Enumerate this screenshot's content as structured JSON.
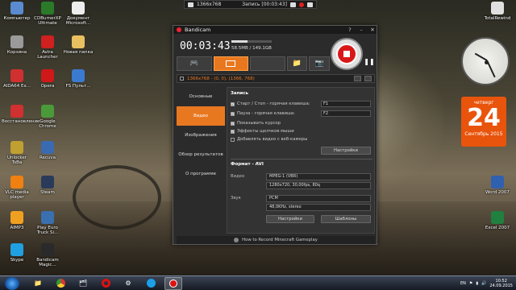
{
  "recording_bar": {
    "resolution": "1366x768",
    "status": "Запись [00:03:43]"
  },
  "desktop_icons": [
    {
      "label": "Компьютер",
      "color": "#5a8ad0"
    },
    {
      "label": "CDBurnerXP Ultimate",
      "color": "#2a7a2a"
    },
    {
      "label": "Документ Microsoft...",
      "color": "#eeeeee"
    },
    {
      "label": "Корзина",
      "color": "#9a9a9a"
    },
    {
      "label": "Avira Launcher",
      "color": "#d02020"
    },
    {
      "label": "Новая папка",
      "color": "#e8c060"
    },
    {
      "label": "AIDA64 Ex...",
      "color": "#d03030"
    },
    {
      "label": "Opera",
      "color": "#d01818"
    },
    {
      "label": "FS Пульт...",
      "color": "#3a7ad0"
    },
    {
      "label": "Восстановление",
      "color": "#d03030"
    },
    {
      "label": "Google Chrome",
      "color": "#4a9a3a"
    },
    {
      "label": "Unlocker TsBa",
      "color": "#c0a030"
    },
    {
      "label": "Recuva",
      "color": "#3a6ab0"
    },
    {
      "label": "VLC media player",
      "color": "#f08010"
    },
    {
      "label": "Steam",
      "color": "#2a3a5a"
    },
    {
      "label": "AIMP3",
      "color": "#f0a020"
    },
    {
      "label": "Play Euro Truck Si...",
      "color": "#3a70b0"
    },
    {
      "label": "Skype",
      "color": "#20a0e0"
    },
    {
      "label": "Bandicam Magic...",
      "color": "#2a2a2a"
    },
    {
      "label": "TotalRewind",
      "color": "#e0e0e0"
    },
    {
      "label": "Word 2007",
      "color": "#3060b0"
    },
    {
      "label": "Excel 2007",
      "color": "#208040"
    }
  ],
  "calendar": {
    "weekday": "четверг",
    "day": "24",
    "month_year": "Сентябрь 2015"
  },
  "window": {
    "title": "Bandicam",
    "title_buttons": [
      "?",
      "–",
      "✕"
    ],
    "timer": "00:03:43",
    "size_text": "58.5MB / 149.1GB",
    "size_progress": 0.39,
    "region": "1366x768 - (0, 0), (1366, 768)",
    "sidebar": [
      "Основные",
      "Видео",
      "Изображения",
      "Обзор результатов",
      "О программе"
    ],
    "active_sidebar": 1,
    "record_section": "Запись",
    "options": [
      {
        "label": "Старт / Стоп - горячая клавиша:",
        "checked": true,
        "hotkey": "F1"
      },
      {
        "label": "Пауза - горячая клавиша:",
        "checked": true,
        "hotkey": "F2"
      },
      {
        "label": "Показывать курсор",
        "checked": true
      },
      {
        "label": "Эффекты щелчков мыши",
        "checked": true
      },
      {
        "label": "Добавлять видео с веб-камеры",
        "checked": false
      }
    ],
    "settings_button": "Настройки",
    "format_section": "Формат - AVI",
    "video_label": "Видео",
    "video_codec": "MPEG-1 (VBR)",
    "video_details": "1280x720, 30,00fps, 80q",
    "audio_label": "Звук",
    "audio_codec": "PCM",
    "audio_details": "48,0KHz, stereo",
    "format_settings_button": "Настройки",
    "templates_button": "Шаблоны",
    "footer_link": "How to Record Minecraft Gameplay"
  },
  "tray": {
    "lang": "EN",
    "time": "10:52",
    "date": "24.09.2015"
  }
}
